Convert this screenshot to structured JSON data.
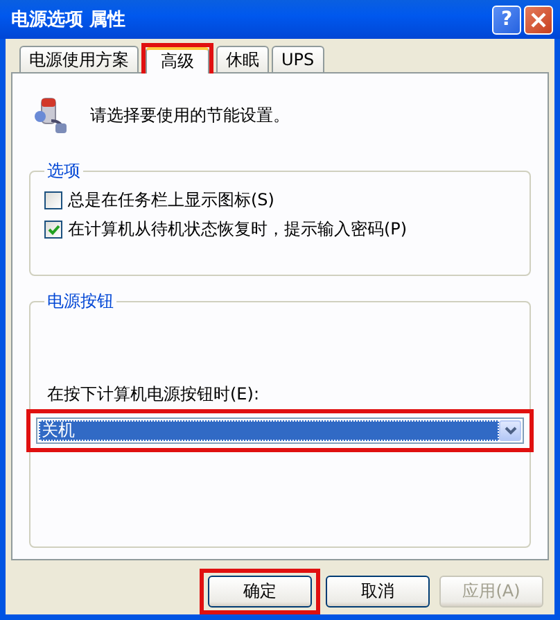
{
  "window": {
    "title": "电源选项 属性",
    "help_button": "?"
  },
  "tabs": [
    {
      "label": "电源使用方案",
      "selected": false,
      "highlighted": false
    },
    {
      "label": "高级",
      "selected": true,
      "highlighted": true
    },
    {
      "label": "休眠",
      "selected": false,
      "highlighted": false
    },
    {
      "label": "UPS",
      "selected": false,
      "highlighted": false
    }
  ],
  "intro": "请选择要使用的节能设置。",
  "options_group": {
    "title": "选项",
    "checkboxes": [
      {
        "label": "总是在任务栏上显示图标(S)",
        "checked": false
      },
      {
        "label": "在计算机从待机状态恢复时，提示输入密码(P)",
        "checked": true
      }
    ]
  },
  "power_group": {
    "title": "电源按钮",
    "prompt": "在按下计算机电源按钮时(E):",
    "dropdown": {
      "value": "关机",
      "highlighted": true
    }
  },
  "buttons": [
    {
      "label": "确定",
      "disabled": false,
      "highlighted": true
    },
    {
      "label": "取消",
      "disabled": false,
      "highlighted": false
    },
    {
      "label": "应用(A)",
      "disabled": true,
      "highlighted": false
    }
  ]
}
